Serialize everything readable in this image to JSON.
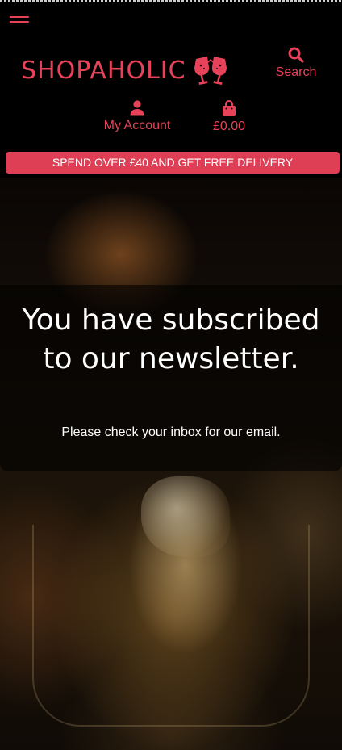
{
  "header": {
    "logo_text": "SHOPAHOLIC",
    "search_label": "Search",
    "account_label": "My Account",
    "cart_total": "£0.00"
  },
  "promo_bar": {
    "text": "SPEND OVER £40 AND GET FREE DELIVERY"
  },
  "hero": {
    "title": "You have subscribed to our newsletter.",
    "subtitle": "Please check your inbox for our email."
  },
  "colors": {
    "accent": "#e8425a",
    "promo_background": "#df3f55",
    "page_background": "#000000",
    "text_light": "#ffffff"
  },
  "icons": [
    "hamburger-menu-icon",
    "cocktail-glasses-icon",
    "search-icon",
    "user-icon",
    "shopping-bag-icon"
  ]
}
